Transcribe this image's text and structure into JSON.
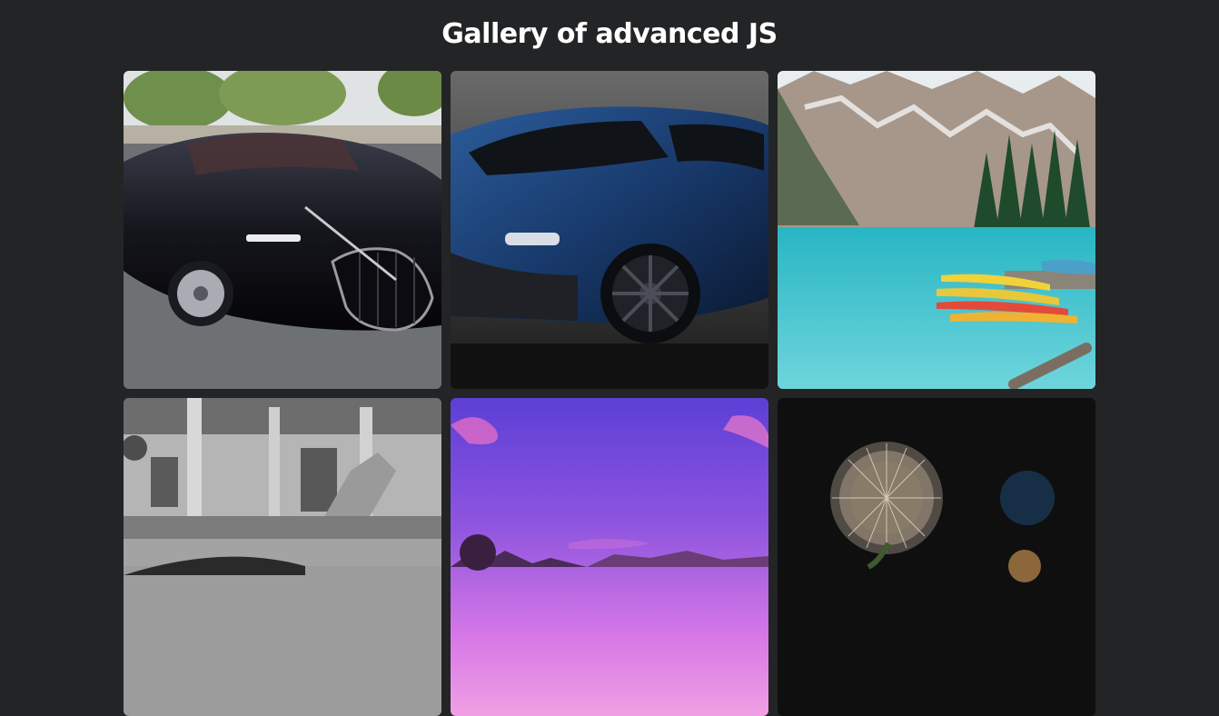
{
  "page": {
    "title": "Gallery of advanced JS"
  },
  "gallery": {
    "images": [
      {
        "subject": "black-hypercar-front-three-quarter"
      },
      {
        "subject": "blue-hypercar-front-three-quarter"
      },
      {
        "subject": "mountain-lake-with-canoes"
      },
      {
        "subject": "grand-palace-staircase-with-car"
      },
      {
        "subject": "purple-sunset-mountain-landscape"
      },
      {
        "subject": "dandelion-seed-head-night"
      }
    ]
  }
}
